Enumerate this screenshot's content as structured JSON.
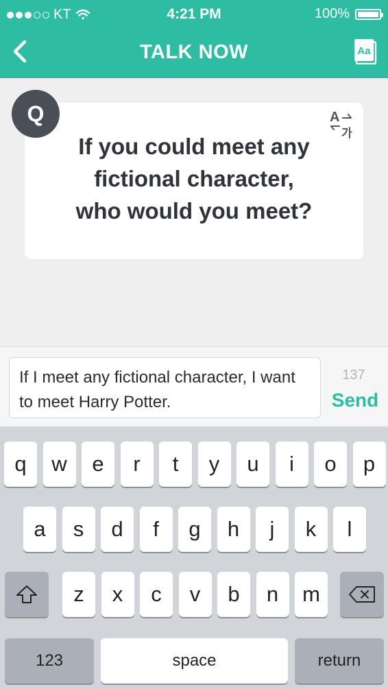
{
  "status_bar": {
    "carrier": "KT",
    "time": "4:21 PM",
    "battery_percent": "100%",
    "signal_bars_filled": 3,
    "signal_bars_total": 5
  },
  "nav": {
    "title": "TALK NOW",
    "back_icon": "chevron-left-icon",
    "font_icon_label": "Aa"
  },
  "question": {
    "badge": "Q",
    "text": "If you could meet any\nfictional character,\nwho would you meet?",
    "translate_icon": {
      "latin": "A",
      "korean": "가"
    }
  },
  "composer": {
    "value": "If I meet any fictional character, I want to meet Harry Potter.",
    "remaining_count": "137",
    "send_label": "Send"
  },
  "keyboard": {
    "row1": [
      "q",
      "w",
      "e",
      "r",
      "t",
      "y",
      "u",
      "i",
      "o",
      "p"
    ],
    "row2": [
      "a",
      "s",
      "d",
      "f",
      "g",
      "h",
      "j",
      "k",
      "l"
    ],
    "row3": [
      "z",
      "x",
      "c",
      "v",
      "b",
      "n",
      "m"
    ],
    "numbers_label": "123",
    "space_label": "space",
    "return_label": "return"
  },
  "colors": {
    "accent": "#2ebda2",
    "badge": "#4a4f57",
    "background": "#efeff0"
  }
}
